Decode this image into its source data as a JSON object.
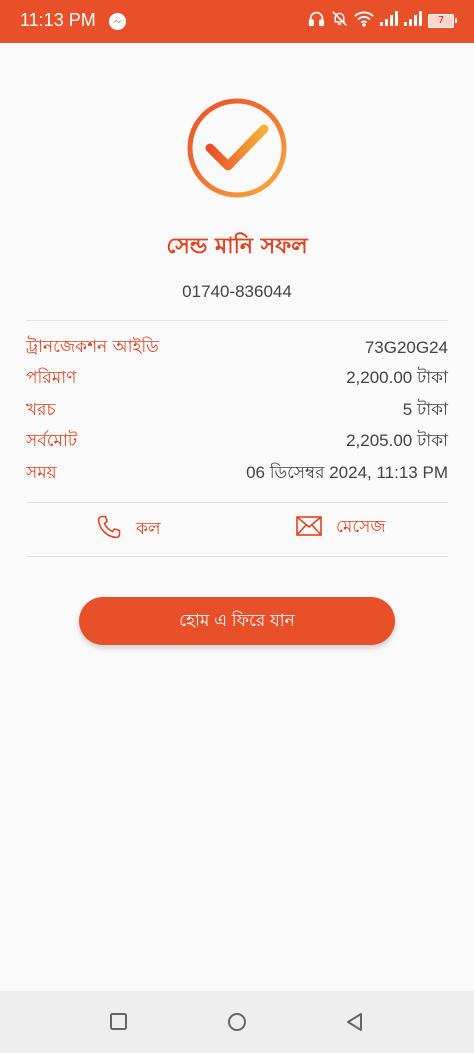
{
  "status_bar": {
    "time": "11:13 PM",
    "battery_level": "7",
    "icons": [
      "messenger-icon",
      "headphones-icon",
      "bell-off-icon",
      "wifi-icon",
      "signal-icon",
      "signal-icon",
      "battery-icon"
    ],
    "accent_color": "#e8502a"
  },
  "result": {
    "icon": "check-circle-icon",
    "title": "সেন্ড মানি সফল",
    "recipient": "01740-836044"
  },
  "details": [
    {
      "label": "ট্রানজেকশন আইডি",
      "value": "73G20G24"
    },
    {
      "label": "পরিমাণ",
      "value": "2,200.00 টাকা"
    },
    {
      "label": "খরচ",
      "value": "5 টাকা"
    },
    {
      "label": "সর্বমোট",
      "value": "2,205.00 টাকা"
    },
    {
      "label": "সময়",
      "value": "06 ডিসেম্বর 2024, 11:13 PM"
    }
  ],
  "actions": {
    "call_label": "কল",
    "call_icon": "phone-icon",
    "message_label": "মেসেজ",
    "message_icon": "envelope-icon"
  },
  "home_button_label": "হোম এ ফিরে যান",
  "nav_bar": {
    "icons": [
      "square-icon",
      "circle-icon",
      "triangle-back-icon"
    ]
  }
}
